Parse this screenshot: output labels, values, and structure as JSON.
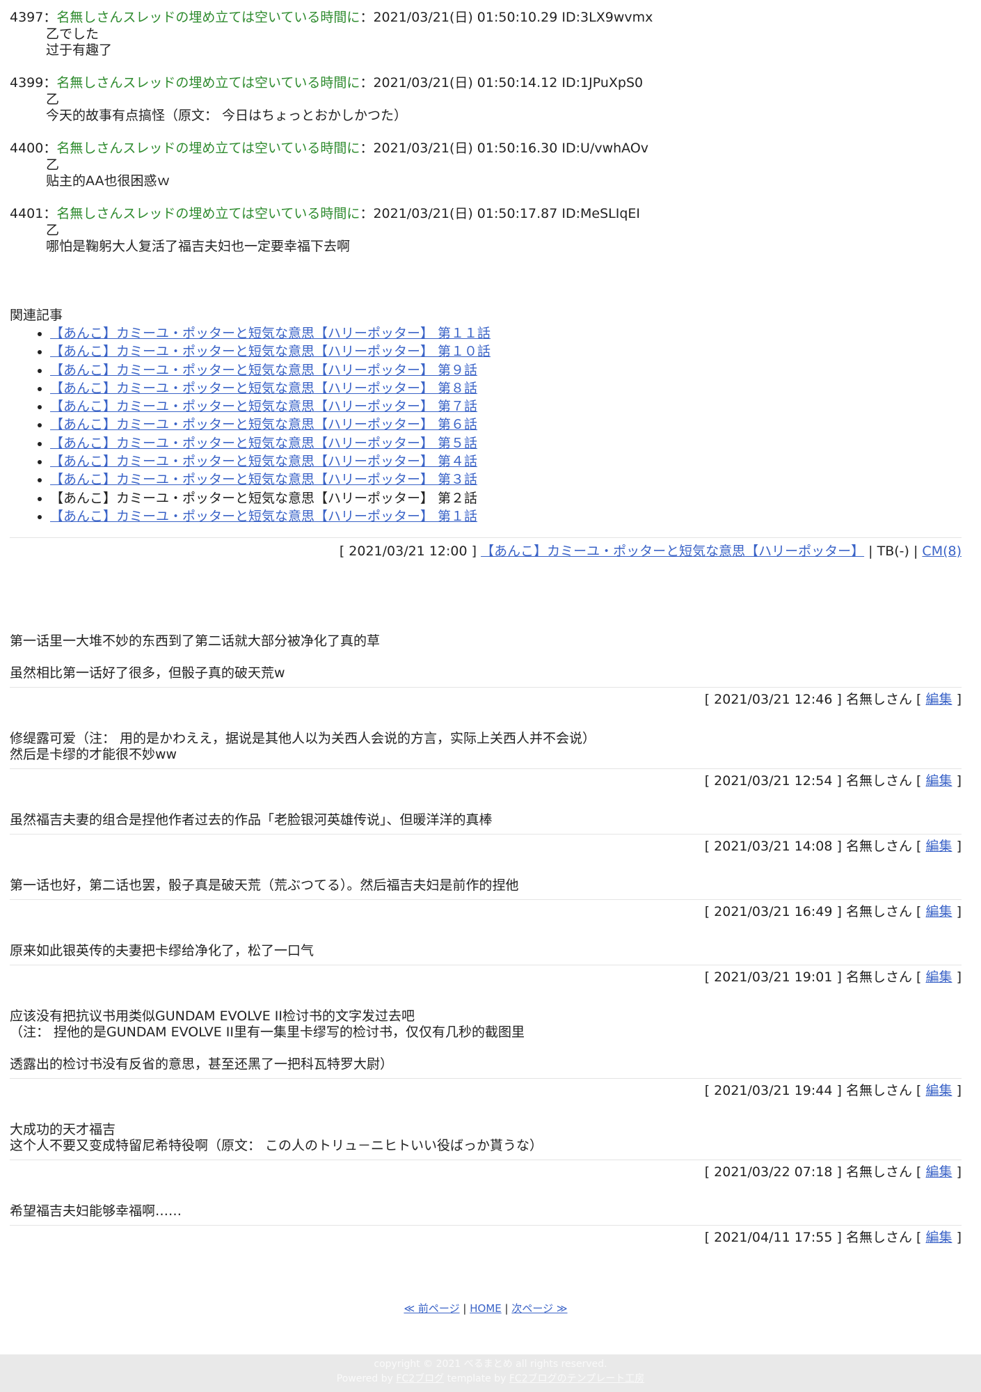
{
  "posts": [
    {
      "num": "4397",
      "sep": "：",
      "name": "名無しさんスレッドの埋め立ては空いている時間に",
      "meta": "：2021/03/21(日) 01:50:10.29 ID:3LX9wvmx",
      "lines": [
        "乙でした",
        "过于有趣了"
      ]
    },
    {
      "num": "4399",
      "sep": "：",
      "name": "名無しさんスレッドの埋め立ては空いている時間に",
      "meta": "：2021/03/21(日) 01:50:14.12 ID:1JPuXpS0",
      "lines": [
        "乙",
        "今天的故事有点搞怪（原文： 今日はちょっとおかしかつた）"
      ]
    },
    {
      "num": "4400",
      "sep": "：",
      "name": "名無しさんスレッドの埋め立ては空いている時間に",
      "meta": "：2021/03/21(日) 01:50:16.30 ID:U/vwhAOv",
      "lines": [
        "乙",
        "贴主的AA也很困惑ｗ"
      ]
    },
    {
      "num": "4401",
      "sep": "：",
      "name": "名無しさんスレッドの埋め立ては空いている時間に",
      "meta": "：2021/03/21(日) 01:50:17.87 ID:MeSLIqEI",
      "lines": [
        "乙",
        "哪怕是鞠躬大人复活了福吉夫妇也一定要幸福下去啊"
      ]
    }
  ],
  "related": {
    "title": "関連記事",
    "items": [
      {
        "label": "【あんこ】カミーユ・ポッターと短気な意思【ハリーポッター】 第１１話",
        "link": true
      },
      {
        "label": "【あんこ】カミーユ・ポッターと短気な意思【ハリーポッター】 第１０話",
        "link": true
      },
      {
        "label": "【あんこ】カミーユ・ポッターと短気な意思【ハリーポッター】 第９話",
        "link": true
      },
      {
        "label": "【あんこ】カミーユ・ポッターと短気な意思【ハリーポッター】 第８話",
        "link": true
      },
      {
        "label": "【あんこ】カミーユ・ポッターと短気な意思【ハリーポッター】 第７話",
        "link": true
      },
      {
        "label": "【あんこ】カミーユ・ポッターと短気な意思【ハリーポッター】 第６話",
        "link": true
      },
      {
        "label": "【あんこ】カミーユ・ポッターと短気な意思【ハリーポッター】 第５話",
        "link": true
      },
      {
        "label": "【あんこ】カミーユ・ポッターと短気な意思【ハリーポッター】 第４話",
        "link": true
      },
      {
        "label": "【あんこ】カミーユ・ポッターと短気な意思【ハリーポッター】 第３話",
        "link": true
      },
      {
        "label": "【あんこ】カミーユ・ポッターと短気な意思【ハリーポッター】 第２話",
        "link": false
      },
      {
        "label": "【あんこ】カミーユ・ポッターと短気な意思【ハリーポッター】 第１話",
        "link": true
      }
    ]
  },
  "entry_footer": {
    "date": "[ 2021/03/21 12:00 ]",
    "category": "【あんこ】カミーユ・ポッターと短気な意思【ハリーポッター】",
    "sep1": "|",
    "tb": "TB(-)",
    "sep2": "|",
    "cm": "CM(8)"
  },
  "comments": [
    {
      "paras": [
        "第一话里一大堆不妙的东西到了第二话就大部分被净化了真的草",
        "",
        "虽然相比第一话好了很多，但骰子真的破天荒w"
      ],
      "date": "[ 2021/03/21 12:46 ]",
      "author": "名無しさん",
      "edit_open": "[",
      "edit": "編集",
      "edit_close": "]"
    },
    {
      "paras": [
        "修缇露可爱（注： 用的是かわええ，据说是其他人以为关西人会说的方言，实际上关西人并不会说）",
        "然后是卡缪的才能很不妙ww"
      ],
      "date": "[ 2021/03/21 12:54 ]",
      "author": "名無しさん",
      "edit_open": "[",
      "edit": "編集",
      "edit_close": "]"
    },
    {
      "paras": [
        "虽然福吉夫妻的组合是捏他作者过去的作品「老脸银河英雄传说」、但暖洋洋的真棒"
      ],
      "date": "[ 2021/03/21 14:08 ]",
      "author": "名無しさん",
      "edit_open": "[",
      "edit": "編集",
      "edit_close": "]"
    },
    {
      "paras": [
        "第一话也好，第二话也罢，骰子真是破天荒（荒ぶつてる）。然后福吉夫妇是前作的捏他"
      ],
      "date": "[ 2021/03/21 16:49 ]",
      "author": "名無しさん",
      "edit_open": "[",
      "edit": "編集",
      "edit_close": "]"
    },
    {
      "paras": [
        "原来如此银英传的夫妻把卡缪给净化了，松了一口气"
      ],
      "date": "[ 2021/03/21 19:01 ]",
      "author": "名無しさん",
      "edit_open": "[",
      "edit": "編集",
      "edit_close": "]"
    },
    {
      "paras": [
        "应该没有把抗议书用类似GUNDAM EVOLVE II检讨书的文字发过去吧",
        "（注： 捏他的是GUNDAM EVOLVE II里有一集里卡缪写的检讨书，仅仅有几秒的截图里",
        "",
        "透露出的检讨书没有反省的意思，甚至还黑了一把科瓦特罗大尉）"
      ],
      "date": "[ 2021/03/21 19:44 ]",
      "author": "名無しさん",
      "edit_open": "[",
      "edit": "編集",
      "edit_close": "]"
    },
    {
      "paras": [
        "大成功的天才福吉",
        "这个人不要又变成特留尼希特役啊（原文： この人のトリュ－ニヒトいい役ばっか貰うな）"
      ],
      "date": "[ 2021/03/22 07:18 ]",
      "author": "名無しさん",
      "edit_open": "[",
      "edit": "編集",
      "edit_close": "]"
    },
    {
      "paras": [
        "希望福吉夫妇能够幸福啊……"
      ],
      "date": "[ 2021/04/11 17:55 ]",
      "author": "名無しさん",
      "edit_open": "[",
      "edit": "編集",
      "edit_close": "]"
    }
  ],
  "pager": {
    "prev": "≪ 前ページ",
    "sep1": "|",
    "home": "HOME",
    "sep2": "|",
    "next": "次ページ ≫"
  },
  "footer": {
    "copyright": "copyright © 2021 べるまとめ all rights reserved.",
    "powered_prefix": "Powered by",
    "powered_link": "FC2ブログ",
    "template_prefix": "template by",
    "template_link": "FC2ブログのテンプレート工房"
  },
  "colors": {
    "poster_name": "#2e8b2e",
    "link": "#3a63c7",
    "footer_bg": "#e9e9e9"
  }
}
